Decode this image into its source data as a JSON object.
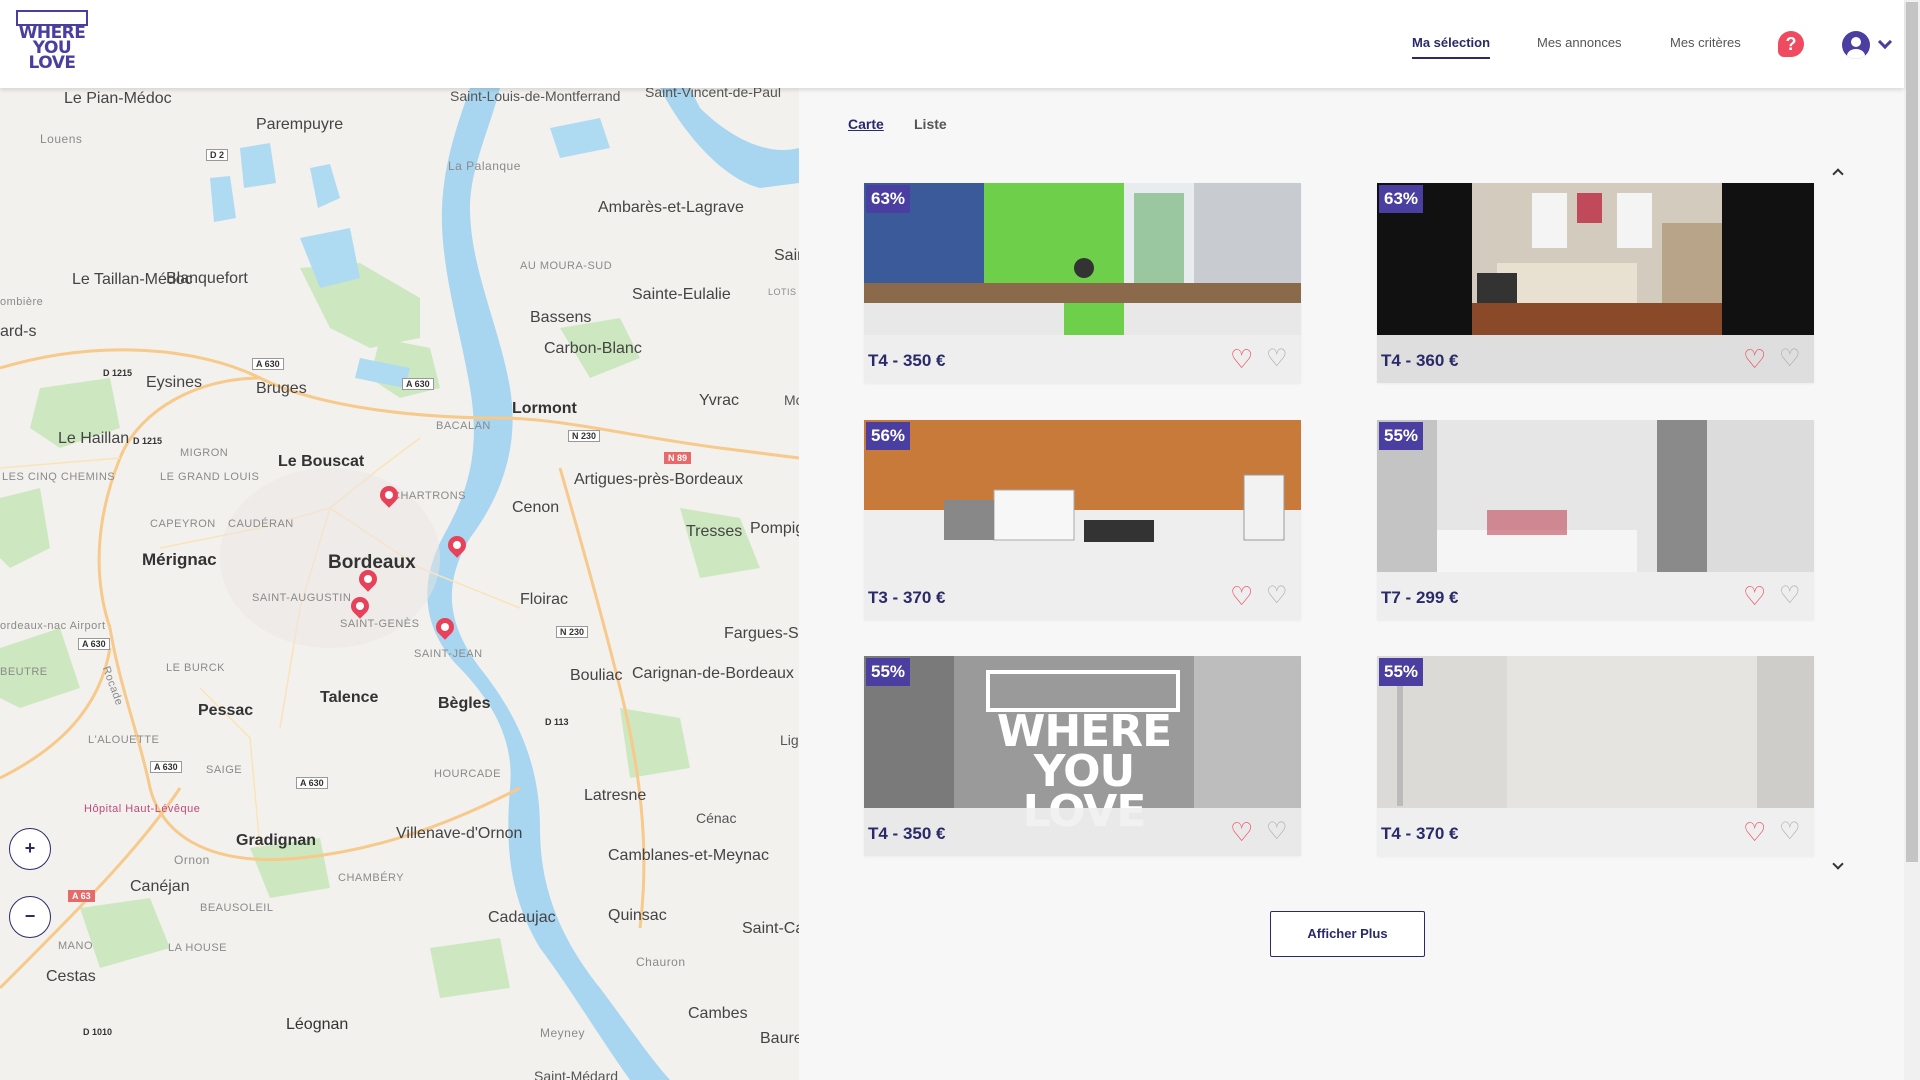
{
  "header": {
    "logo_text": "WHERE YOU LOVE",
    "nav": [
      {
        "label": "Ma sélection",
        "active": true
      },
      {
        "label": "Mes annonces",
        "active": false
      },
      {
        "label": "Mes critères",
        "active": false
      }
    ],
    "help_icon": "help-icon",
    "user_icon": "user-account-icon"
  },
  "view_tabs": [
    {
      "label": "Carte",
      "active": true
    },
    {
      "label": "Liste",
      "active": false
    }
  ],
  "map": {
    "zoom_in": "+",
    "zoom_out": "−",
    "labels": {
      "pian": "Le Pian-Médoc",
      "parempuyre": "Parempuyre",
      "st_louis": "Saint-Louis-de-Montferrand",
      "st_vincent": "Saint-Vincent-de-Paul",
      "louens": "Louens",
      "la_palanque": "La Palanque",
      "ambares": "Ambarès-et-Lagrave",
      "sair": "Sair",
      "taillan": "Le Taillan-Médoc",
      "blanquefort": "Blanquefort",
      "au_moura": "AU MOURA-SUD",
      "ste_eulalie": "Sainte-Eulalie",
      "ombiere": "ombière",
      "lotis": "LOTIS LE C GRA",
      "bassens": "Bassens",
      "ard": "ard-s",
      "carbon_blanc": "Carbon-Blanc",
      "eysines": "Eysines",
      "bruges": "Bruges",
      "lormont": "Lormont",
      "yvrac": "Yvrac",
      "mo": "Mo",
      "bacalan": "BACALAN",
      "le_haillan": "Le Haillan",
      "migron": "MIGRON",
      "les_cinq": "LES CINQ CHEMINS",
      "grand_louis": "LE GRAND LOUIS",
      "le_bouscat": "Le Bouscat",
      "chartrons": "CHARTRONS",
      "artigues": "Artigues-près-Bordeaux",
      "cenon": "Cenon",
      "capeyron": "CAPEYRON",
      "cauderan": "CAUDÉRAN",
      "tresses": "Tresses",
      "pompig": "Pompig",
      "merignac": "Mérignac",
      "bordeaux": "Bordeaux",
      "st_augustin": "SAINT-AUGUSTIN",
      "floirac": "Floirac",
      "bordeaux_airport": "ordeaux-nac Airport",
      "st_genes": "SAINT-GENÈS",
      "farguessh": "Fargues-Saint-Hilair",
      "st_jean": "SAINT-JEAN",
      "beutre": "BEUTRE",
      "le_burck": "LE BURCK",
      "bouliac": "Bouliac",
      "carignan": "Carignan-de-Bordeaux",
      "pessac": "Pessac",
      "talence": "Talence",
      "begles": "Bègles",
      "alouette": "L'ALOUETTE",
      "saige": "SAIGE",
      "hourcade": "HOURCADE",
      "lig": "Lig Bo",
      "hopital": "Hôpital Haut-Lévêque",
      "latresne": "Latresne",
      "cenac": "Cénac",
      "gradignan": "Gradignan",
      "villenave": "Villenave-d'Ornon",
      "ornon": "Ornon",
      "camblanes": "Camblanes-et-Meynac",
      "canejan": "Canéjan",
      "chambery": "CHAMBÉRY",
      "beausoleil": "BEAUSOLEIL",
      "cadaujac": "Cadaujac",
      "quinsac": "Quinsac",
      "st_caprais": "Saint-Ca de-Bord",
      "mano": "MANO",
      "la_house": "LA HOUSE",
      "chauron": "Chauron",
      "cestas": "Cestas",
      "cambes": "Cambes",
      "baure": "Baure",
      "leognan": "Léognan",
      "meyney": "Meyney",
      "st_medard": "Saint-Médard",
      "rocade": "Rocade"
    },
    "roads": [
      "D 2",
      "A 630",
      "A 630",
      "D 1215",
      "D 1215",
      "N 230",
      "N 89",
      "A 630",
      "N 230",
      "D 113",
      "A 630",
      "A 630",
      "A 63",
      "D 1010"
    ]
  },
  "listings": [
    {
      "match": "63%",
      "title": "T4 - 350 €"
    },
    {
      "match": "63%",
      "title": "T4 - 360 €"
    },
    {
      "match": "56%",
      "title": "T3 - 370 €"
    },
    {
      "match": "55%",
      "title": "T7 - 299 €"
    },
    {
      "match": "55%",
      "title": "T4 - 350 €"
    },
    {
      "match": "55%",
      "title": "T4 - 370 €"
    }
  ],
  "placeholder_logo_text": "WHERE YOU LOVE",
  "show_more": "Afficher Plus",
  "colors": {
    "accent": "#4a3fa0",
    "heart": "#ef4a5f",
    "pin": "#e8425a",
    "river": "#a8d5f0"
  }
}
